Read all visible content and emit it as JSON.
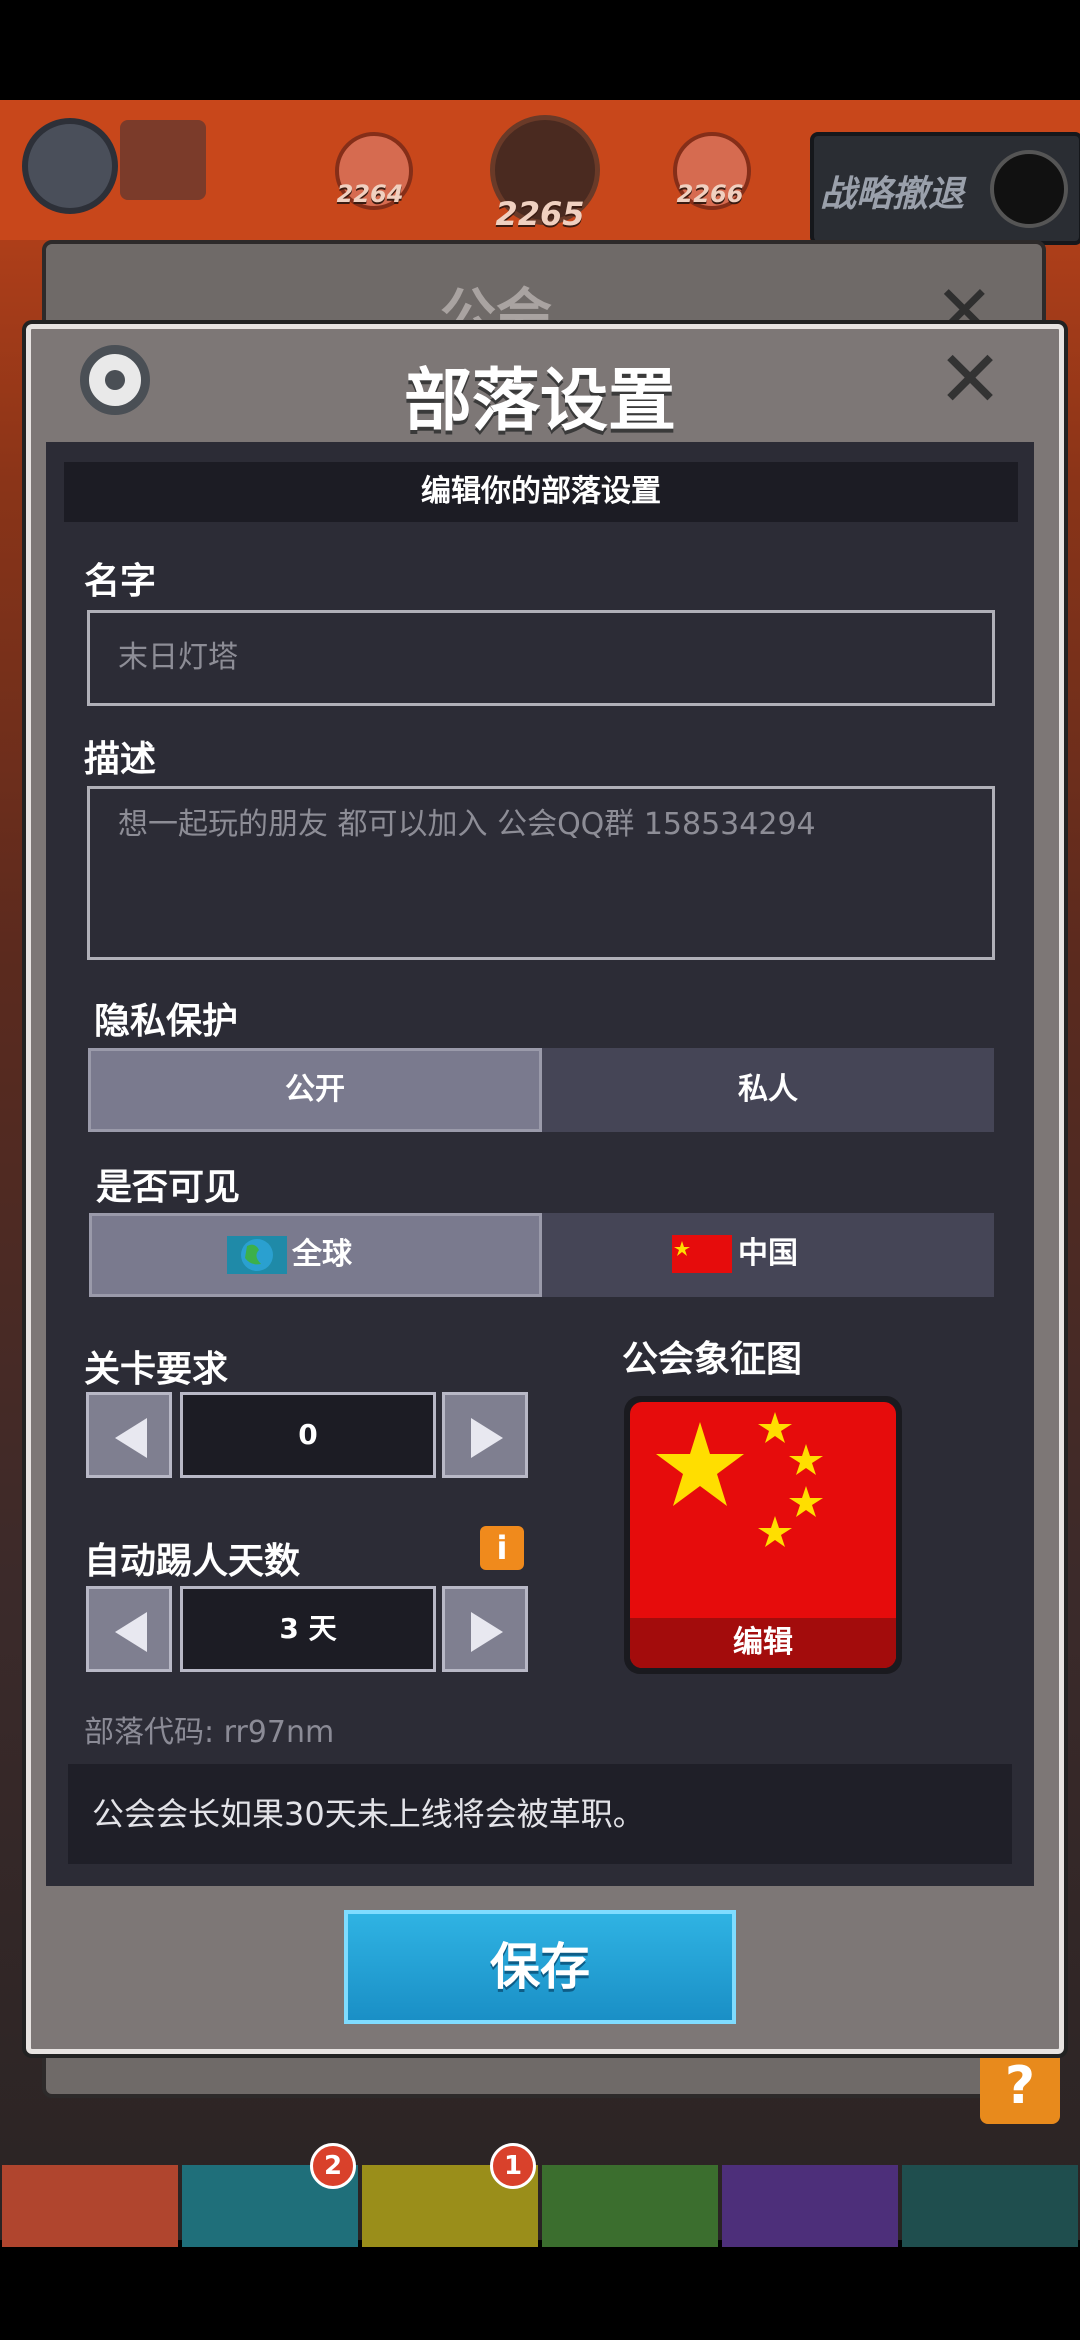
{
  "background": {
    "levels": [
      "2264",
      "2265",
      "2266"
    ],
    "retreat_label": "战略撤退",
    "guild_dialog_title": "公会",
    "tab_badges": [
      "2",
      "1"
    ],
    "help_label": "?"
  },
  "dialog": {
    "title": "部落设置",
    "close": "✕",
    "subheader": "编辑你的部落设置",
    "name": {
      "label": "名字",
      "value": "末日灯塔"
    },
    "description": {
      "label": "描述",
      "value": "想一起玩的朋友 都可以加入 公会QQ群 158534294"
    },
    "privacy": {
      "label": "隐私保护",
      "options": [
        "公开",
        "私人"
      ],
      "selected": "公开"
    },
    "visibility": {
      "label": "是否可见",
      "options": [
        "全球",
        "中国"
      ],
      "selected": "全球"
    },
    "level_requirement": {
      "label": "关卡要求",
      "value": "0"
    },
    "auto_kick": {
      "label": "自动踢人天数",
      "value": "3 天",
      "info_icon": "i"
    },
    "emblem": {
      "label": "公会象征图",
      "edit_label": "编辑"
    },
    "clan_code": "部落代码: rr97nm",
    "notice": "公会会长如果30天未上线将会被革职。",
    "save_label": "保存"
  },
  "colors": {
    "accent_save": "#1a8fc6",
    "emblem_red": "#e60c0c",
    "info_orange": "#f08a1c"
  }
}
